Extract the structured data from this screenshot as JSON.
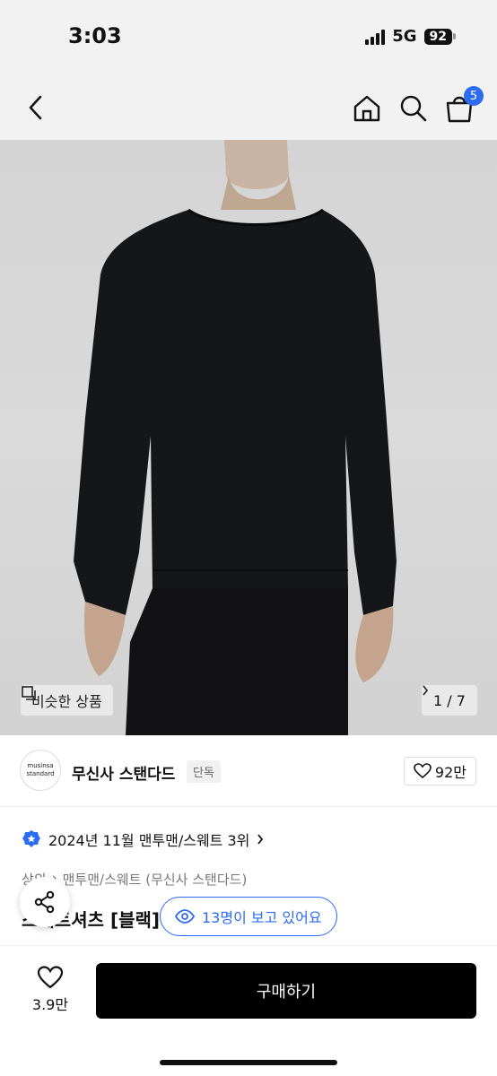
{
  "status": {
    "time": "3:03",
    "network": "5G",
    "battery": "92"
  },
  "header": {
    "cart_count": "5",
    "icons": [
      "back-icon",
      "home-icon",
      "search-icon",
      "cart-icon"
    ]
  },
  "gallery": {
    "similar_label": "비슷한 상품",
    "counter": "1 / 7",
    "current": 1,
    "total": 7
  },
  "brand": {
    "logo_line1": "musinsa",
    "logo_line2": "standard",
    "name": "무신사 스탠다드",
    "tag": "단독",
    "likes": "92만"
  },
  "ranking": {
    "text": "2024년 11월 맨투맨/스웨트 3위"
  },
  "breadcrumb": {
    "level1": "상의",
    "level2": "맨투맨/스웨트 (무신사 스탠다드)"
  },
  "product": {
    "title": "스웨트셔츠 [블랙]"
  },
  "viewers": {
    "text": "13명이 보고 있어요"
  },
  "bottom": {
    "likes": "3.9만",
    "buy_label": "구매하기"
  },
  "colors": {
    "accent": "#2c6cf2",
    "button": "#000000"
  }
}
